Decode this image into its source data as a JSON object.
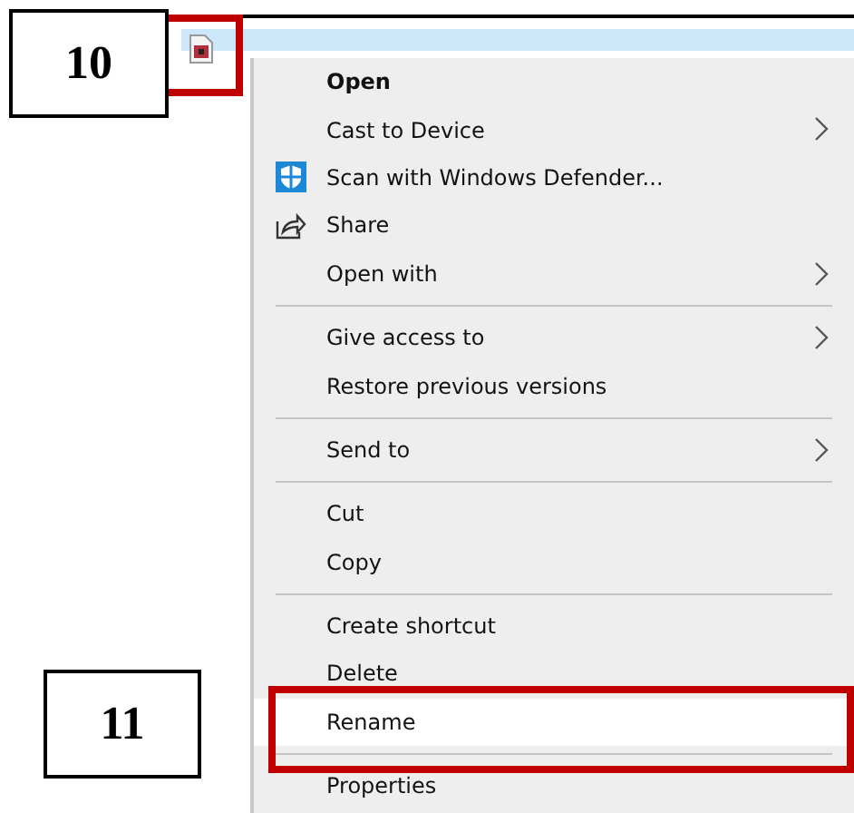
{
  "callouts": [
    {
      "label": "10"
    },
    {
      "label": "11"
    }
  ],
  "menu": {
    "items": [
      {
        "kind": "item",
        "label": "Open",
        "bold": true,
        "submenu": false,
        "selected": false
      },
      {
        "kind": "item",
        "label": "Cast to Device",
        "bold": false,
        "submenu": true,
        "selected": false
      },
      {
        "kind": "shield-item",
        "label": "Scan with Windows Defender...",
        "bold": false,
        "submenu": false,
        "selected": false
      },
      {
        "kind": "share-item",
        "label": "Share",
        "bold": false,
        "submenu": false,
        "selected": false
      },
      {
        "kind": "item",
        "label": "Open with",
        "bold": false,
        "submenu": true,
        "selected": false
      },
      {
        "kind": "separator"
      },
      {
        "kind": "item",
        "label": "Give access to",
        "bold": false,
        "submenu": true,
        "selected": false
      },
      {
        "kind": "item",
        "label": "Restore previous versions",
        "bold": false,
        "submenu": false,
        "selected": false
      },
      {
        "kind": "separator"
      },
      {
        "kind": "item",
        "label": "Send to",
        "bold": false,
        "submenu": true,
        "selected": false
      },
      {
        "kind": "separator"
      },
      {
        "kind": "item",
        "label": "Cut",
        "bold": false,
        "submenu": false,
        "selected": false
      },
      {
        "kind": "item",
        "label": "Copy",
        "bold": false,
        "submenu": false,
        "selected": false
      },
      {
        "kind": "separator"
      },
      {
        "kind": "item",
        "label": "Create shortcut",
        "bold": false,
        "submenu": false,
        "selected": false
      },
      {
        "kind": "item",
        "label": "Delete",
        "bold": false,
        "submenu": false,
        "selected": false
      },
      {
        "kind": "item",
        "label": "Rename",
        "bold": false,
        "submenu": false,
        "selected": true
      },
      {
        "kind": "separator"
      },
      {
        "kind": "item",
        "label": "Properties",
        "bold": false,
        "submenu": false,
        "selected": false
      }
    ]
  }
}
